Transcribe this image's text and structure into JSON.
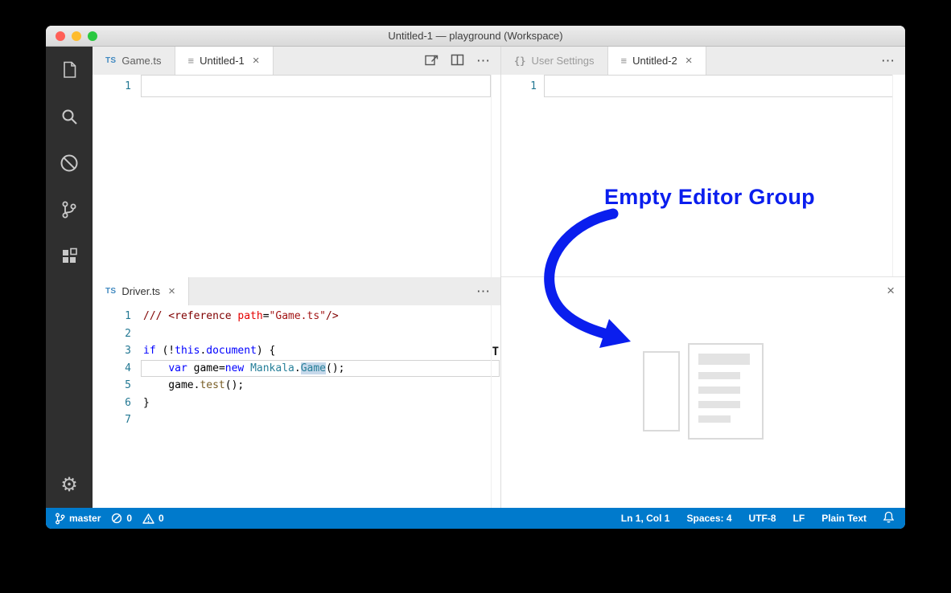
{
  "window": {
    "title": "Untitled-1 — playground (Workspace)"
  },
  "colors": {
    "statusbar_bg": "#007acc",
    "annotation": "#0a1eee"
  },
  "activity_bar": {
    "gear_glyph": "⚙",
    "icons": [
      "files",
      "search",
      "debug-disabled",
      "git-branch",
      "extensions",
      "settings-gear"
    ]
  },
  "left_top_group": {
    "tabs": [
      {
        "badge": "TS",
        "label": "Game.ts"
      },
      {
        "glyph": "≡",
        "label": "Untitled-1",
        "close": "×"
      }
    ],
    "more": "⋯",
    "line_number": "1"
  },
  "right_top_group": {
    "tabs": [
      {
        "glyph": "{}",
        "label": "User Settings"
      },
      {
        "glyph": "≡",
        "label": "Untitled-2",
        "close": "×"
      }
    ],
    "more": "⋯",
    "line_number": "1"
  },
  "bottom_left_group": {
    "tabs": [
      {
        "badge": "TS",
        "label": "Driver.ts",
        "close": "×"
      }
    ],
    "more": "⋯"
  },
  "empty_group": {
    "close": "×"
  },
  "annotation": {
    "text": "Empty Editor Group"
  },
  "code": {
    "cursor_glyph": "T",
    "word_highlight": "#c6d8ea",
    "colors": {
      "tag": "#800000",
      "attr": "#e50000",
      "string": "#a31515",
      "keyword": "#0000ff",
      "type": "#267f99",
      "func": "#795e26",
      "plain": "#000000"
    },
    "lines": [
      {
        "n": "1",
        "tokens": [
          [
            "/// <reference ",
            "tag"
          ],
          [
            "path",
            "attr"
          ],
          [
            "=",
            "plain"
          ],
          [
            "\"Game.ts\"",
            "string"
          ],
          [
            "/>",
            "tag"
          ]
        ]
      },
      {
        "n": "2",
        "tokens": []
      },
      {
        "n": "3",
        "tokens": [
          [
            "if",
            "keyword"
          ],
          [
            " (!",
            "plain"
          ],
          [
            "this",
            "keyword"
          ],
          [
            ".",
            "plain"
          ],
          [
            "document",
            "keyword"
          ],
          [
            ") {",
            "plain"
          ]
        ]
      },
      {
        "n": "4",
        "current": true,
        "tokens": [
          [
            "    ",
            "plain"
          ],
          [
            "var",
            "keyword"
          ],
          [
            " game",
            "plain"
          ],
          [
            "=",
            "plain"
          ],
          [
            "new",
            "keyword"
          ],
          [
            " ",
            "plain"
          ],
          [
            "Mankala",
            "type"
          ],
          [
            ".",
            "plain"
          ],
          [
            "Game",
            "type",
            "hl"
          ],
          [
            "();",
            "plain"
          ]
        ]
      },
      {
        "n": "5",
        "tokens": [
          [
            "    game.",
            "plain"
          ],
          [
            "test",
            "func"
          ],
          [
            "();",
            "plain"
          ]
        ]
      },
      {
        "n": "6",
        "tokens": [
          [
            "}",
            "plain"
          ]
        ]
      },
      {
        "n": "7",
        "tokens": []
      }
    ]
  },
  "status_bar": {
    "branch": "master",
    "errors": "0",
    "warnings": "0",
    "right": [
      {
        "label": "Ln 1, Col 1"
      },
      {
        "label": "Spaces: 4"
      },
      {
        "label": "UTF-8"
      },
      {
        "label": "LF"
      },
      {
        "label": "Plain Text"
      }
    ]
  }
}
